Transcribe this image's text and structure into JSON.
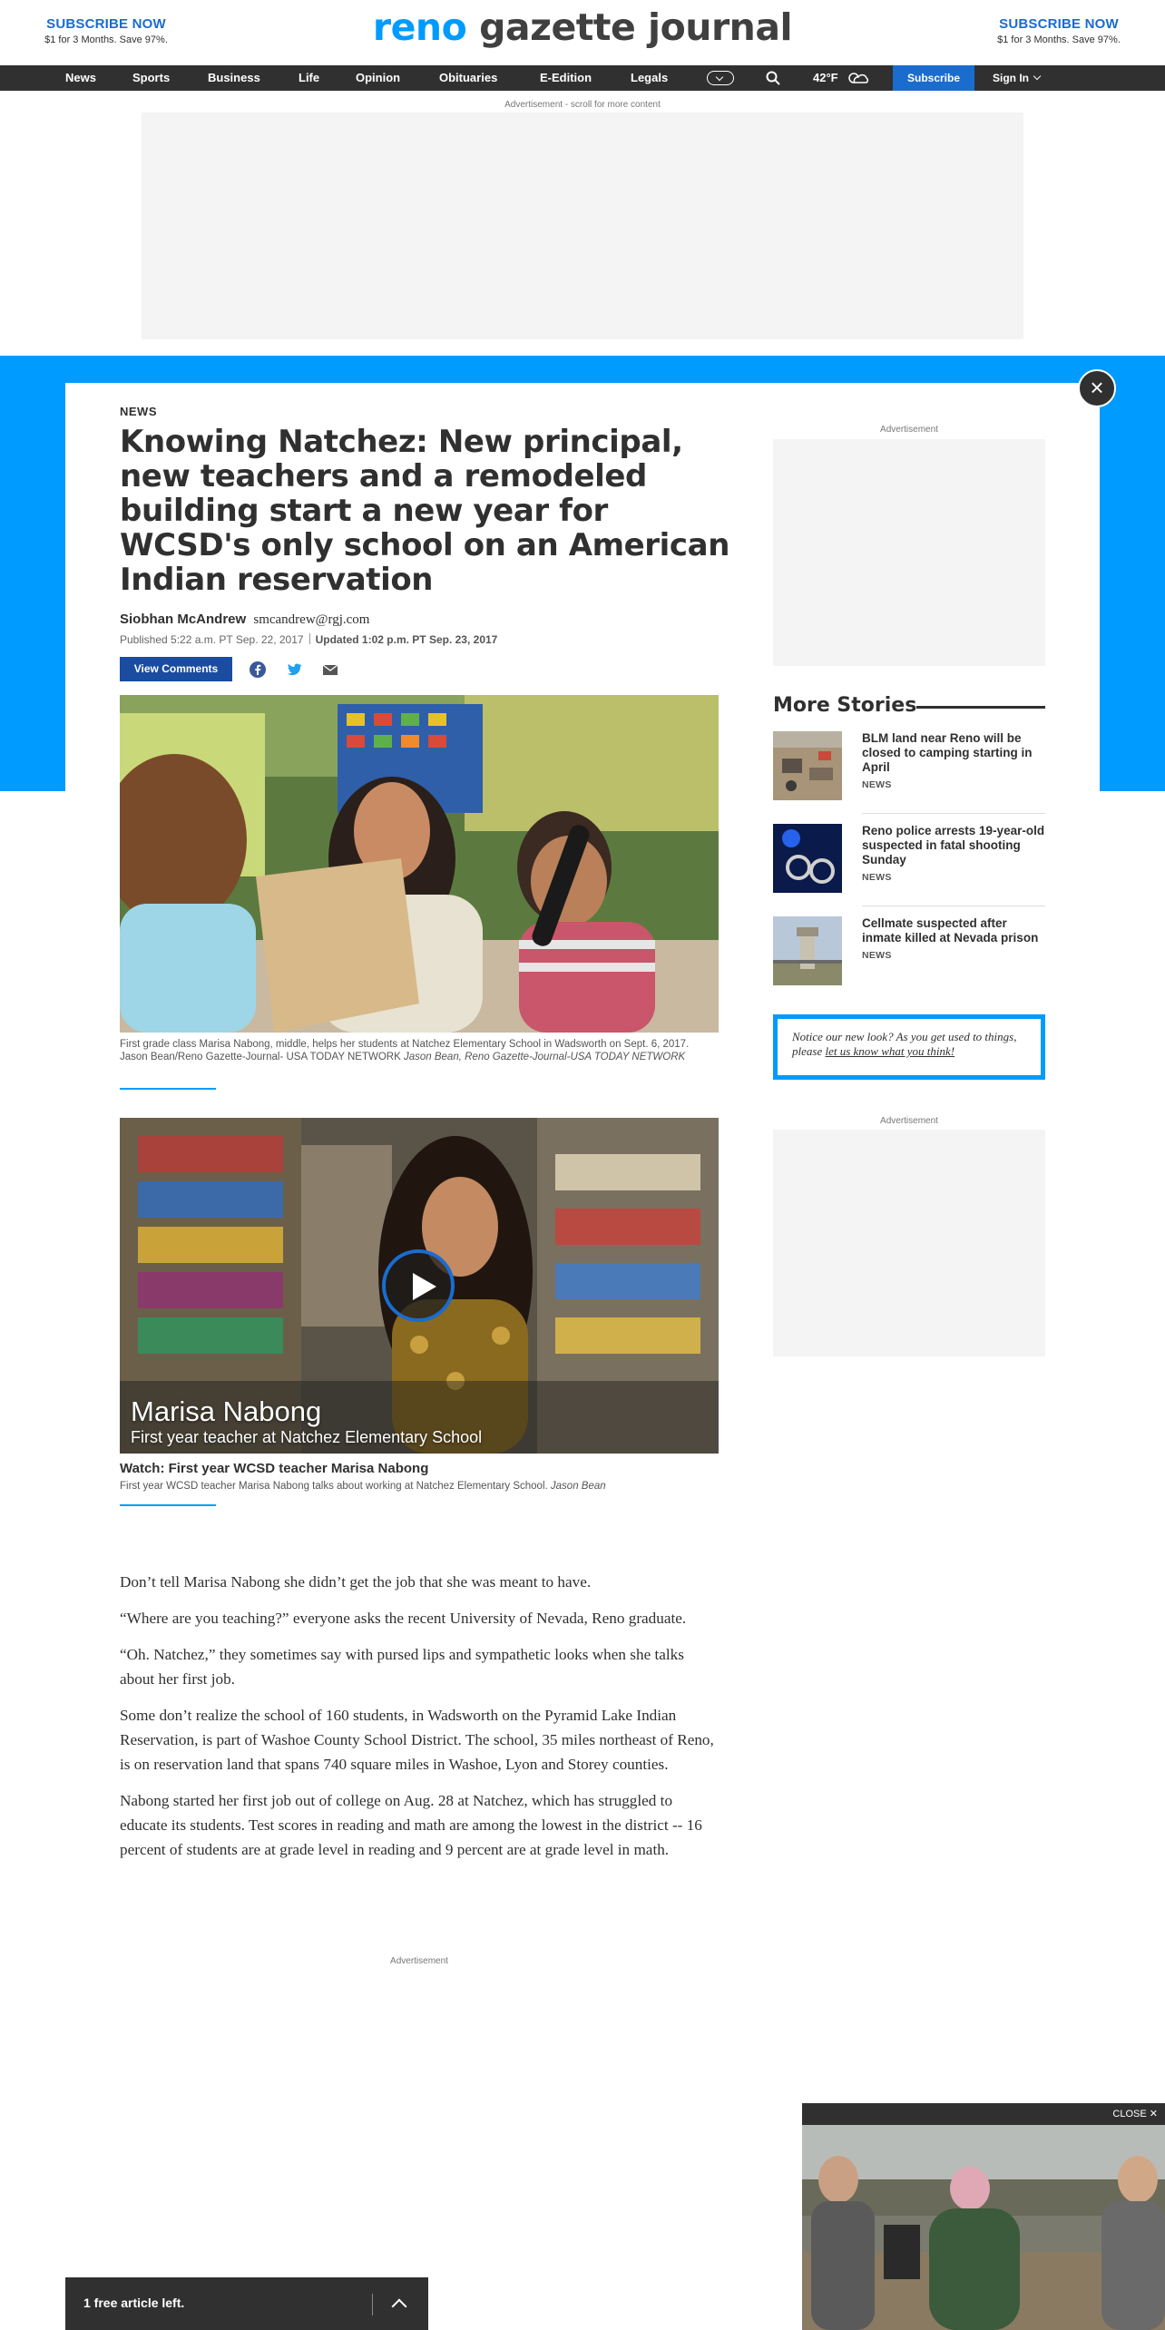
{
  "header": {
    "subscribe_left": {
      "title": "SUBSCRIBE NOW",
      "subtitle": "$1 for 3 Months. Save 97%."
    },
    "subscribe_right": {
      "title": "SUBSCRIBE NOW",
      "subtitle": "$1 for 3 Months. Save 97%."
    },
    "logo_part1": "reno",
    "logo_part2": "gazette journal",
    "brand_color": "#009bff"
  },
  "nav": {
    "items": [
      "News",
      "Sports",
      "Business",
      "Life",
      "Opinion",
      "Obituaries",
      "E-Edition",
      "Legals"
    ],
    "temperature": "42°F",
    "subscribe_label": "Subscribe",
    "signin_label": "Sign In",
    "icons": [
      "chevron-down-icon",
      "search-icon",
      "weather-icon"
    ]
  },
  "ads": {
    "top_note": "Advertisement - scroll for more content",
    "side_label": "Advertisement",
    "body_label": "Advertisement"
  },
  "article": {
    "section": "NEWS",
    "headline": "Knowing Natchez: New principal, new teachers and a remodeled building start a new year for WCSD's only school on an American Indian reservation",
    "author": "Siobhan McAndrew",
    "email": "smcandrew@rgj.com",
    "published": "Published 5:22 a.m. PT Sep. 22, 2017",
    "updated": "Updated 1:02 p.m. PT Sep. 23, 2017",
    "comments_label": "View Comments",
    "share_icons": [
      "facebook-icon",
      "twitter-icon",
      "email-icon"
    ],
    "photo_caption": "First grade class Marisa Nabong, middle, helps her students at Natchez Elementary School in Wadsworth on Sept. 6, 2017. Jason Bean/Reno Gazette-Journal- USA TODAY NETWORK",
    "photo_credit": "Jason Bean, Reno Gazette-Journal-USA TODAY NETWORK",
    "video": {
      "overlay_name": "Marisa Nabong",
      "overlay_subtitle": "First year teacher at Natchez Elementary School",
      "title": "Watch: First year WCSD teacher Marisa Nabong",
      "caption": "First year WCSD teacher Marisa Nabong talks about working at Natchez Elementary School.",
      "credit": "Jason Bean"
    },
    "paragraphs": [
      "Don’t tell Marisa Nabong she didn’t get the job that she was meant to have.",
      "“Where are you teaching?” everyone asks the recent University of Nevada, Reno graduate.",
      "“Oh. Natchez,” they sometimes say with pursed lips and sympathetic looks when she talks about her first job.",
      "Some don’t realize the school of 160 students, in Wadsworth on the Pyramid Lake Indian Reservation, is part of Washoe County School District. The school, 35 miles northeast of Reno, is on reservation land that spans 740 square miles in Washoe, Lyon and Storey counties.",
      "Nabong started her first job out of college on Aug. 28 at Natchez, which has struggled to educate its students. Test scores in reading and math are among the lowest in the district -- 16 percent of students are at grade level in reading and 9 percent are at grade level in math."
    ]
  },
  "sidebar": {
    "more_stories_title": "More Stories",
    "stories": [
      {
        "title": "BLM land near Reno will be closed to camping starting in April",
        "tag": "NEWS"
      },
      {
        "title": "Reno police arrests 19-year-old suspected in fatal shooting Sunday",
        "tag": "NEWS"
      },
      {
        "title": "Cellmate suspected after inmate killed at Nevada prison",
        "tag": "NEWS"
      }
    ],
    "notice_text": "Notice our new look? As you get used to things, please",
    "notice_link": "let us know what you think!"
  },
  "footer": {
    "free_articles": "1 free article left.",
    "video_close": "CLOSE"
  }
}
